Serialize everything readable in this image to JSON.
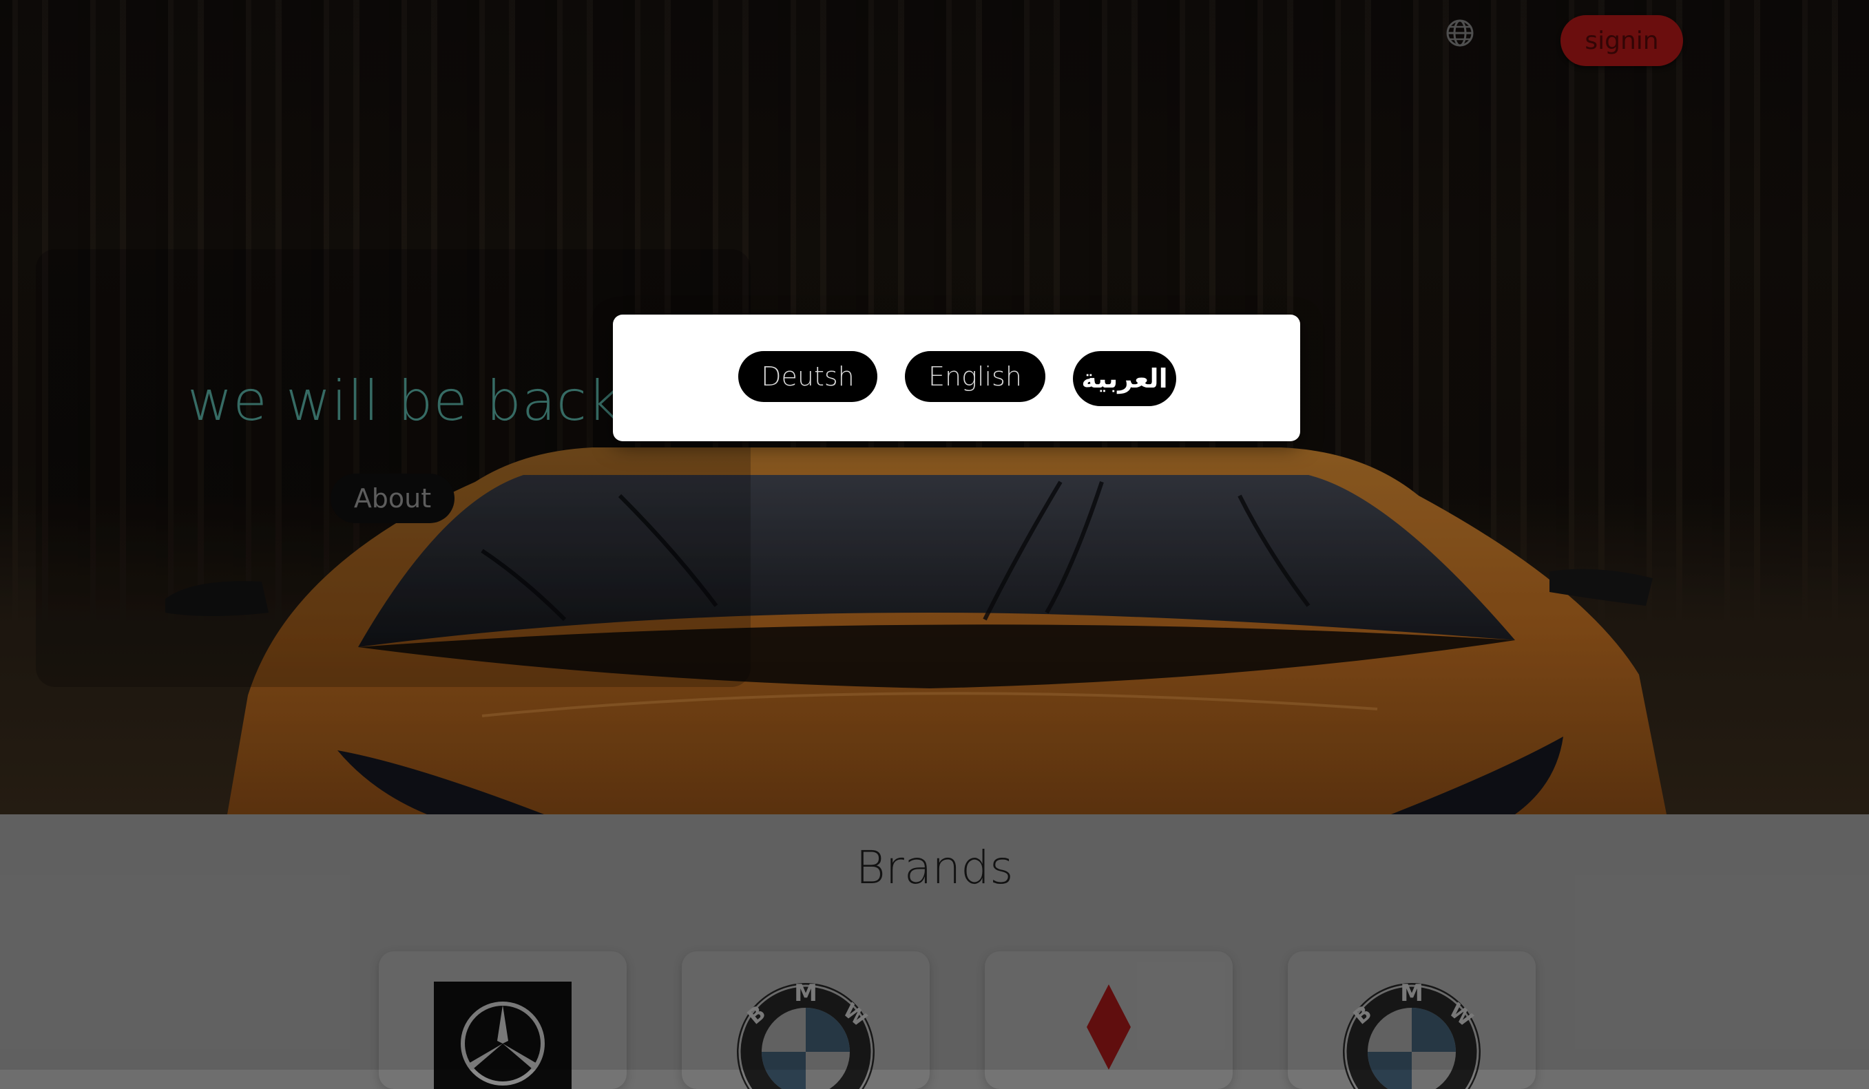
{
  "header": {
    "language_icon": "globe-icon",
    "signin_label": "signin"
  },
  "hero": {
    "title": "we will be back",
    "about_label": "About"
  },
  "brands": {
    "title": "Brands",
    "items": [
      {
        "logo": "mercedes-logo"
      },
      {
        "logo": "bmw-logo"
      },
      {
        "logo": "renault-logo"
      },
      {
        "logo": "bmw-logo"
      }
    ]
  },
  "language_modal": {
    "options": [
      {
        "label": "Deutsh"
      },
      {
        "label": "English"
      },
      {
        "label": "العربية",
        "active": true
      }
    ]
  },
  "colors": {
    "signin_bg": "#7a1010",
    "hero_title": "#3e7a72",
    "car_orange": "#c9792a"
  }
}
